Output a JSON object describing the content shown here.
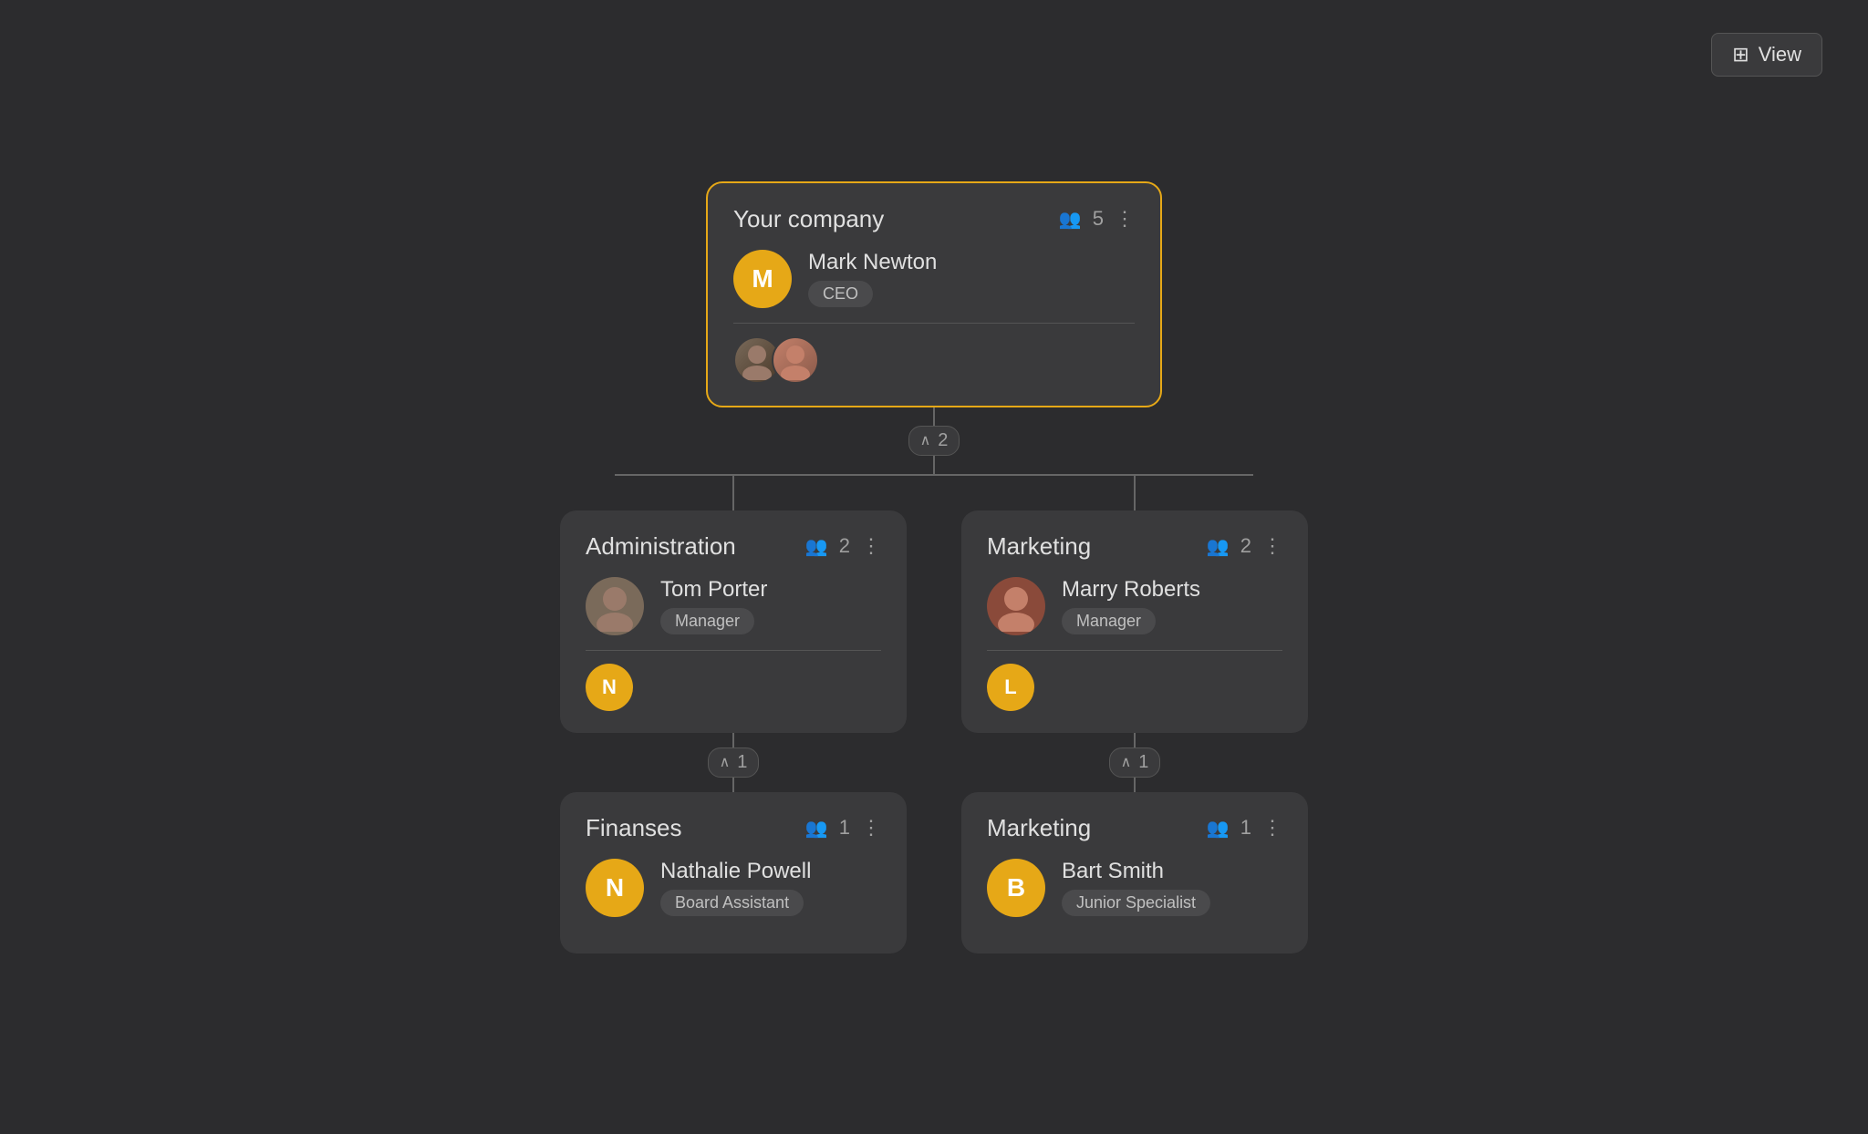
{
  "toolbar": {
    "view_label": "View"
  },
  "root": {
    "title": "Your company",
    "count": 5,
    "person": {
      "name": "Mark Newton",
      "role": "CEO",
      "avatar_letter": "M"
    },
    "collapse_count": "2"
  },
  "level1": [
    {
      "id": "administration",
      "title": "Administration",
      "count": 2,
      "person": {
        "name": "Tom Porter",
        "role": "Manager",
        "avatar_type": "photo"
      },
      "sub_letter": "N",
      "collapse_count": "1"
    },
    {
      "id": "marketing",
      "title": "Marketing",
      "count": 2,
      "person": {
        "name": "Marry Roberts",
        "role": "Manager",
        "avatar_type": "photo"
      },
      "sub_letter": "L",
      "collapse_count": "1"
    }
  ],
  "level2": [
    {
      "id": "finanses",
      "title": "Finanses",
      "count": 1,
      "person": {
        "name": "Nathalie Powell",
        "role": "Board Assistant",
        "avatar_letter": "N"
      }
    },
    {
      "id": "marketing2",
      "title": "Marketing",
      "count": 1,
      "person": {
        "name": "Bart Smith",
        "role": "Junior Specialist",
        "avatar_letter": "B"
      }
    }
  ]
}
